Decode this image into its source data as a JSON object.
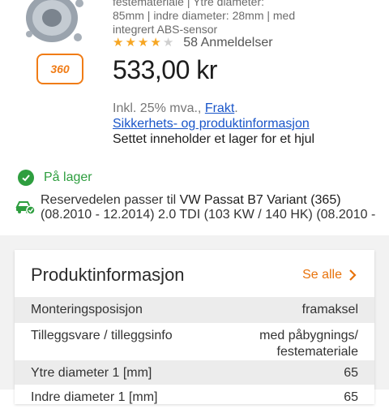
{
  "product": {
    "description_lines": [
      "festemateriale | Ytre diameter:",
      "85mm | indre diameter: 28mm | med",
      "integrert ABS-sensor"
    ],
    "rating": 4,
    "rating_max": 5,
    "reviews": "58 Anmeldelser",
    "price": "533,00 kr",
    "tax_prefix": "Inkl. 25% mva., ",
    "freight_link": "Frakt",
    "tax_suffix": ".",
    "safety_link": "Sikkerhets- og produktinformasjon",
    "set_info": "Settet inneholder et lager for et hjul",
    "view360": "360"
  },
  "stock": {
    "label": "På lager",
    "color": "#2e9e3f"
  },
  "fitment": {
    "prefix": "Reservedelen passer til ",
    "vehicle": "VW Passat B7 Variant (365)",
    "details": "(08.2010 - 12.2014) 2.0 TDI (103 KW / 140 HK) (08.2010 -"
  },
  "product_info": {
    "title": "Produktinformasjon",
    "see_all": "Se alle",
    "rows": [
      {
        "key": "Monteringsposisjon",
        "value": "framaksel"
      },
      {
        "key": "Tilleggsvare / tilleggsinfo",
        "value_lines": [
          "med påbygnings/",
          "festemateriale"
        ]
      },
      {
        "key": "Ytre diameter 1 [mm]",
        "value": "65"
      },
      {
        "key": "Indre diameter 1 [mm]",
        "value": "65"
      }
    ]
  },
  "colors": {
    "accent": "#e8730c",
    "link": "#1a56c9",
    "star": "#f6a623"
  }
}
